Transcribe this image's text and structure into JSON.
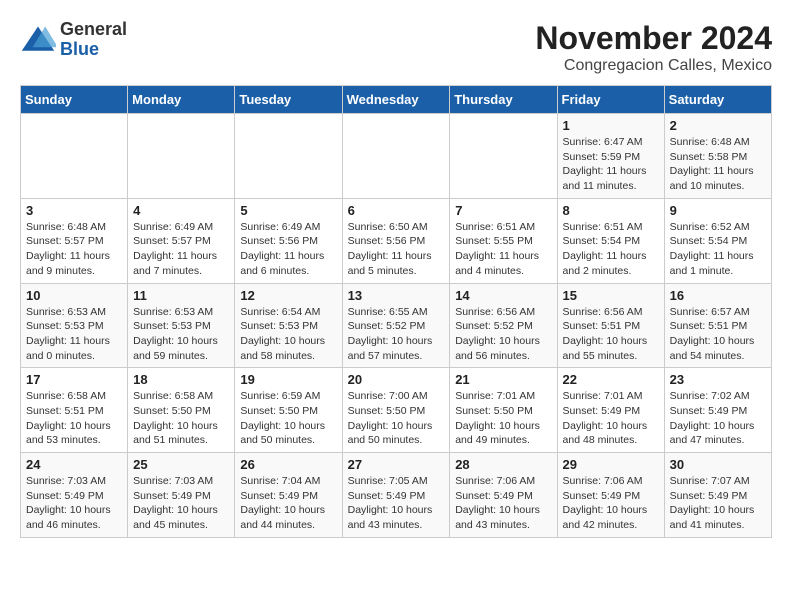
{
  "header": {
    "logo_general": "General",
    "logo_blue": "Blue",
    "month_title": "November 2024",
    "location": "Congregacion Calles, Mexico"
  },
  "weekdays": [
    "Sunday",
    "Monday",
    "Tuesday",
    "Wednesday",
    "Thursday",
    "Friday",
    "Saturday"
  ],
  "weeks": [
    [
      {
        "day": "",
        "info": ""
      },
      {
        "day": "",
        "info": ""
      },
      {
        "day": "",
        "info": ""
      },
      {
        "day": "",
        "info": ""
      },
      {
        "day": "",
        "info": ""
      },
      {
        "day": "1",
        "info": "Sunrise: 6:47 AM\nSunset: 5:59 PM\nDaylight: 11 hours and 11 minutes."
      },
      {
        "day": "2",
        "info": "Sunrise: 6:48 AM\nSunset: 5:58 PM\nDaylight: 11 hours and 10 minutes."
      }
    ],
    [
      {
        "day": "3",
        "info": "Sunrise: 6:48 AM\nSunset: 5:57 PM\nDaylight: 11 hours and 9 minutes."
      },
      {
        "day": "4",
        "info": "Sunrise: 6:49 AM\nSunset: 5:57 PM\nDaylight: 11 hours and 7 minutes."
      },
      {
        "day": "5",
        "info": "Sunrise: 6:49 AM\nSunset: 5:56 PM\nDaylight: 11 hours and 6 minutes."
      },
      {
        "day": "6",
        "info": "Sunrise: 6:50 AM\nSunset: 5:56 PM\nDaylight: 11 hours and 5 minutes."
      },
      {
        "day": "7",
        "info": "Sunrise: 6:51 AM\nSunset: 5:55 PM\nDaylight: 11 hours and 4 minutes."
      },
      {
        "day": "8",
        "info": "Sunrise: 6:51 AM\nSunset: 5:54 PM\nDaylight: 11 hours and 2 minutes."
      },
      {
        "day": "9",
        "info": "Sunrise: 6:52 AM\nSunset: 5:54 PM\nDaylight: 11 hours and 1 minute."
      }
    ],
    [
      {
        "day": "10",
        "info": "Sunrise: 6:53 AM\nSunset: 5:53 PM\nDaylight: 11 hours and 0 minutes."
      },
      {
        "day": "11",
        "info": "Sunrise: 6:53 AM\nSunset: 5:53 PM\nDaylight: 10 hours and 59 minutes."
      },
      {
        "day": "12",
        "info": "Sunrise: 6:54 AM\nSunset: 5:53 PM\nDaylight: 10 hours and 58 minutes."
      },
      {
        "day": "13",
        "info": "Sunrise: 6:55 AM\nSunset: 5:52 PM\nDaylight: 10 hours and 57 minutes."
      },
      {
        "day": "14",
        "info": "Sunrise: 6:56 AM\nSunset: 5:52 PM\nDaylight: 10 hours and 56 minutes."
      },
      {
        "day": "15",
        "info": "Sunrise: 6:56 AM\nSunset: 5:51 PM\nDaylight: 10 hours and 55 minutes."
      },
      {
        "day": "16",
        "info": "Sunrise: 6:57 AM\nSunset: 5:51 PM\nDaylight: 10 hours and 54 minutes."
      }
    ],
    [
      {
        "day": "17",
        "info": "Sunrise: 6:58 AM\nSunset: 5:51 PM\nDaylight: 10 hours and 53 minutes."
      },
      {
        "day": "18",
        "info": "Sunrise: 6:58 AM\nSunset: 5:50 PM\nDaylight: 10 hours and 51 minutes."
      },
      {
        "day": "19",
        "info": "Sunrise: 6:59 AM\nSunset: 5:50 PM\nDaylight: 10 hours and 50 minutes."
      },
      {
        "day": "20",
        "info": "Sunrise: 7:00 AM\nSunset: 5:50 PM\nDaylight: 10 hours and 50 minutes."
      },
      {
        "day": "21",
        "info": "Sunrise: 7:01 AM\nSunset: 5:50 PM\nDaylight: 10 hours and 49 minutes."
      },
      {
        "day": "22",
        "info": "Sunrise: 7:01 AM\nSunset: 5:49 PM\nDaylight: 10 hours and 48 minutes."
      },
      {
        "day": "23",
        "info": "Sunrise: 7:02 AM\nSunset: 5:49 PM\nDaylight: 10 hours and 47 minutes."
      }
    ],
    [
      {
        "day": "24",
        "info": "Sunrise: 7:03 AM\nSunset: 5:49 PM\nDaylight: 10 hours and 46 minutes."
      },
      {
        "day": "25",
        "info": "Sunrise: 7:03 AM\nSunset: 5:49 PM\nDaylight: 10 hours and 45 minutes."
      },
      {
        "day": "26",
        "info": "Sunrise: 7:04 AM\nSunset: 5:49 PM\nDaylight: 10 hours and 44 minutes."
      },
      {
        "day": "27",
        "info": "Sunrise: 7:05 AM\nSunset: 5:49 PM\nDaylight: 10 hours and 43 minutes."
      },
      {
        "day": "28",
        "info": "Sunrise: 7:06 AM\nSunset: 5:49 PM\nDaylight: 10 hours and 43 minutes."
      },
      {
        "day": "29",
        "info": "Sunrise: 7:06 AM\nSunset: 5:49 PM\nDaylight: 10 hours and 42 minutes."
      },
      {
        "day": "30",
        "info": "Sunrise: 7:07 AM\nSunset: 5:49 PM\nDaylight: 10 hours and 41 minutes."
      }
    ]
  ]
}
